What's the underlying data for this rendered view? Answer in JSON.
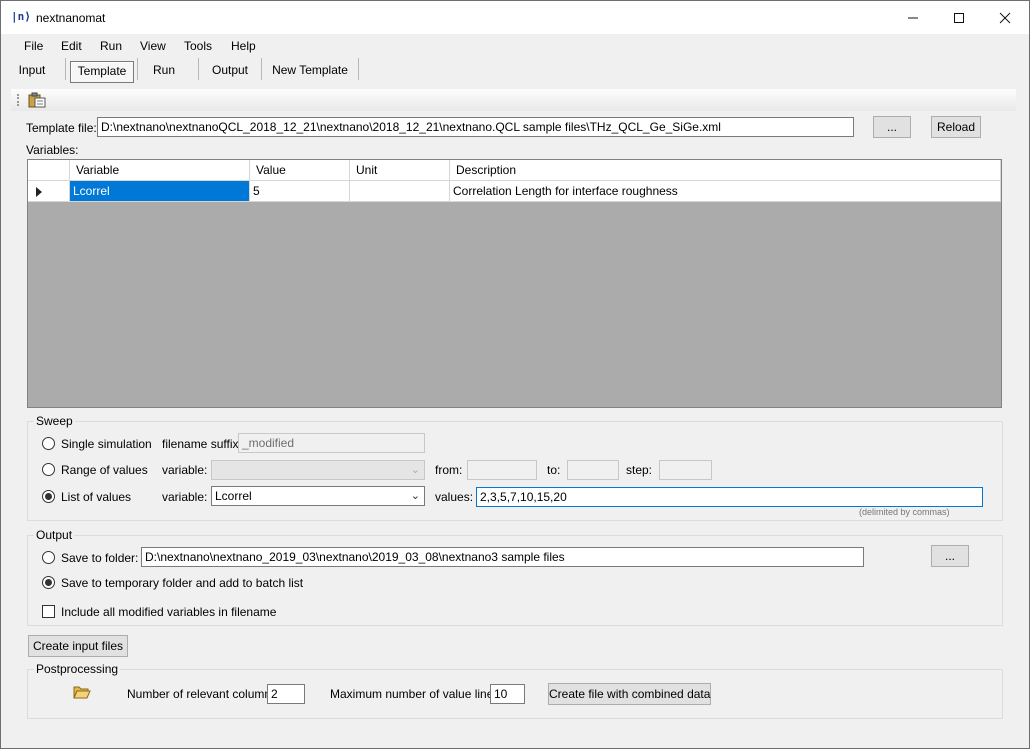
{
  "window": {
    "title": "nextnanomat",
    "app_icon_text": "|n⟩",
    "minimize_icon": "minimize-icon",
    "maximize_icon": "maximize-icon",
    "close_icon": "close-icon"
  },
  "menu": [
    "File",
    "Edit",
    "Run",
    "View",
    "Tools",
    "Help"
  ],
  "tabs": [
    "Input",
    "Template",
    "Run",
    "Output",
    "New Template"
  ],
  "active_tab": "Template",
  "toolbar": {
    "icons": [
      "paste-template-icon"
    ]
  },
  "template": {
    "label": "Template file:",
    "path": "D:\\nextnano\\nextnanoQCL_2018_12_21\\nextnano\\2018_12_21\\nextnano.QCL sample files\\THz_QCL_Ge_SiGe.xml",
    "browse_label": "...",
    "reload_label": "Reload"
  },
  "variables": {
    "label": "Variables:",
    "columns": [
      "Variable",
      "Value",
      "Unit",
      "Description"
    ],
    "rows": [
      {
        "variable": "Lcorrel",
        "value": "5",
        "unit": "",
        "description": "Correlation Length for interface roughness"
      }
    ]
  },
  "sweep": {
    "title": "Sweep",
    "single_label": "Single simulation",
    "suffix_label": "filename suffix:",
    "suffix_value": "_modified",
    "range_label": "Range of values",
    "variable_label": "variable:",
    "range_variable": "",
    "from_label": "from:",
    "to_label": "to:",
    "step_label": "step:",
    "list_label": "List of values",
    "list_variable": "Lcorrel",
    "values_label": "values:",
    "values_value": "2,3,5,7,10,15,20",
    "values_hint": "(delimited by commas)",
    "selected": "list"
  },
  "output": {
    "title": "Output",
    "save_folder_label": "Save to folder:",
    "folder_path": "D:\\nextnano\\nextnano_2019_03\\nextnano\\2019_03_08\\nextnano3 sample files",
    "browse_label": "...",
    "temp_label": "Save to temporary folder and add to batch list",
    "include_label": "Include all modified variables in filename",
    "include_checked": false,
    "selected": "temp"
  },
  "create_input_label": "Create input files",
  "postprocessing": {
    "title": "Postprocessing",
    "folder_icon": "folder-open-icon",
    "column_label": "Number of relevant column:",
    "column_value": "2",
    "max_lines_label": "Maximum number of value lines:",
    "max_lines_value": "10",
    "combine_label": "Create file with combined data"
  }
}
